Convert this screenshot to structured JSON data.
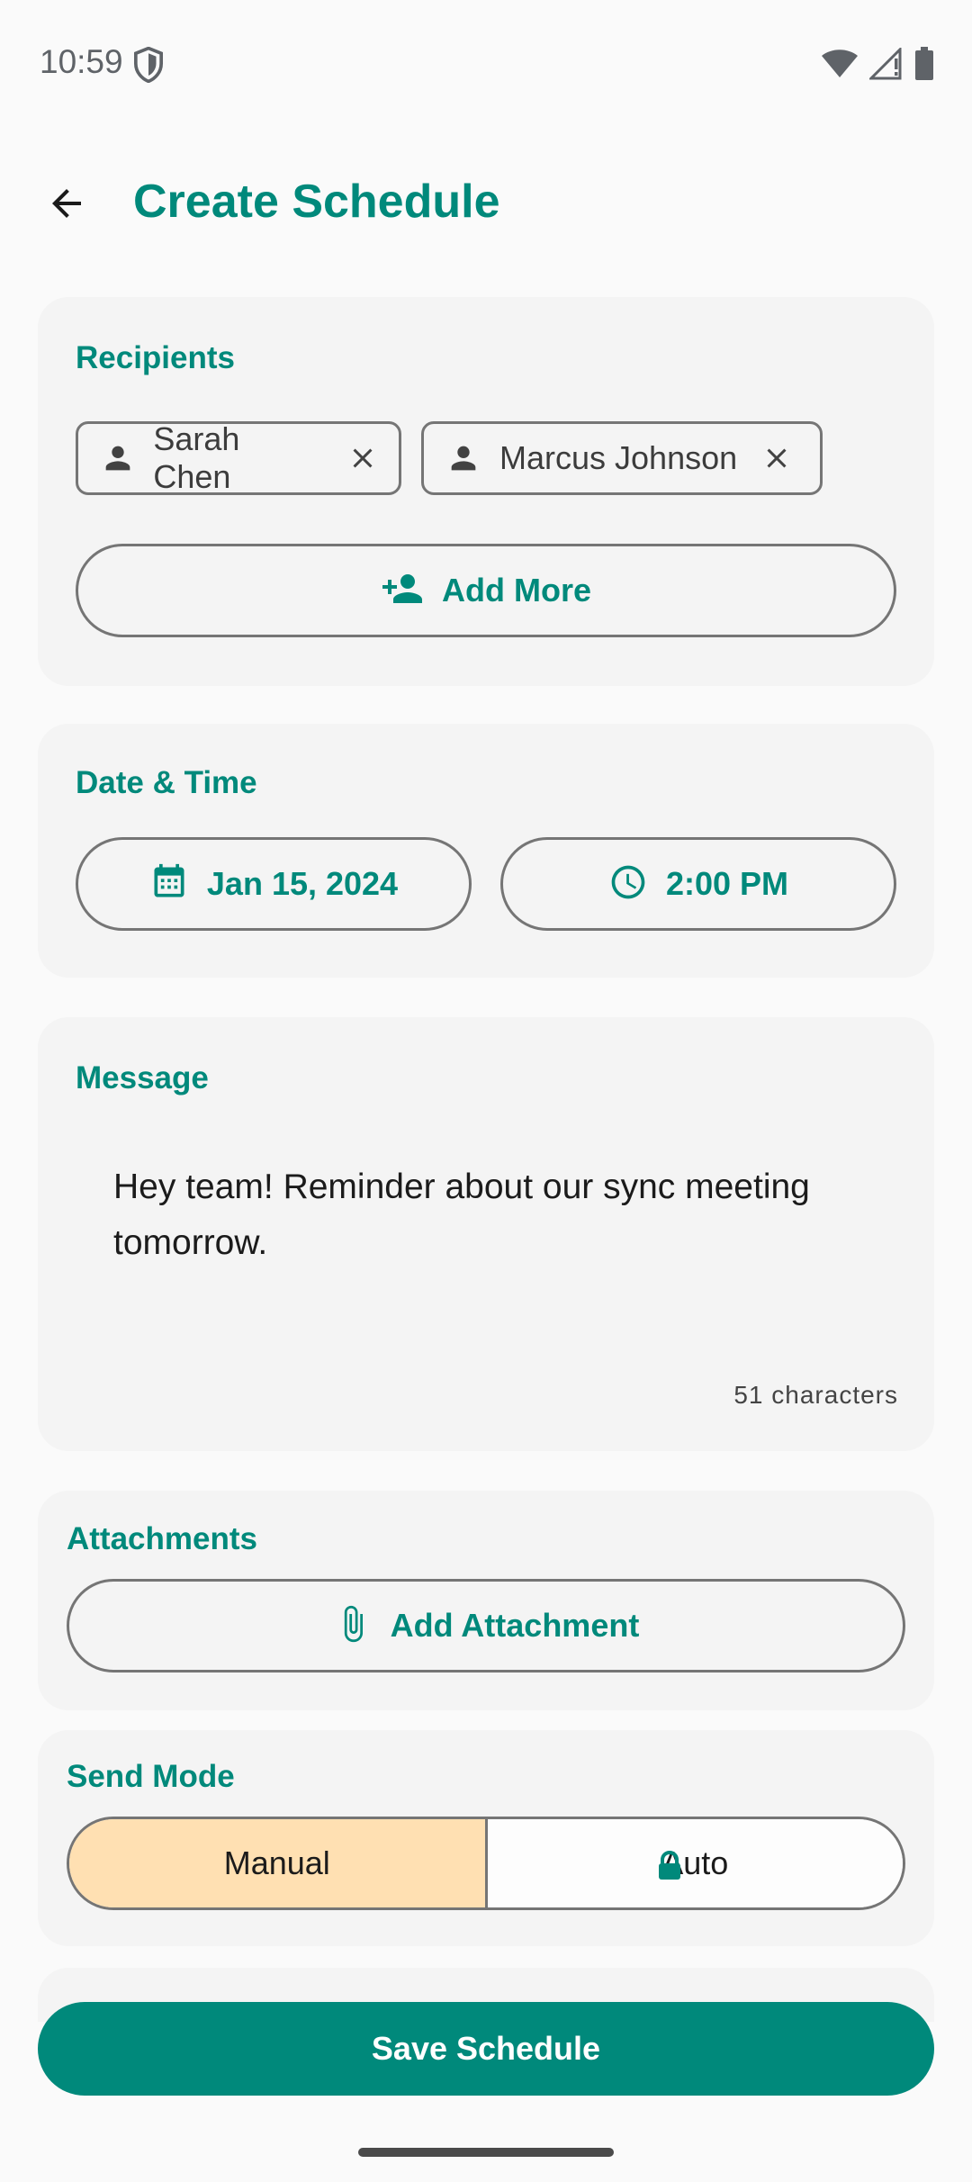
{
  "status_bar": {
    "time": "10:59",
    "icons": [
      "shield-icon",
      "wifi-icon",
      "signal-icon",
      "battery-icon"
    ]
  },
  "header": {
    "title": "Create Schedule",
    "back_icon": "arrow-back-icon"
  },
  "recipients": {
    "title": "Recipients",
    "chips": [
      {
        "label": "Sarah Chen",
        "icon": "person-icon"
      },
      {
        "label": "Marcus Johnson",
        "icon": "person-icon"
      }
    ],
    "add_label": "Add More",
    "add_icon": "person-add-icon"
  },
  "datetime": {
    "title": "Date & Time",
    "date_label": "Jan 15, 2024",
    "date_icon": "calendar-icon",
    "time_label": "2:00 PM",
    "time_icon": "clock-icon"
  },
  "message": {
    "title": "Message",
    "text_line1": "Hey team! Reminder about our sync meeting",
    "text_line2": "tomorrow.",
    "char_count": "51 characters"
  },
  "attachments": {
    "title": "Attachments",
    "add_label": "Add Attachment",
    "add_icon": "paperclip-icon"
  },
  "send_mode": {
    "title": "Send Mode",
    "options": [
      "Manual",
      "Auto"
    ],
    "selected": "Manual",
    "auto_overlay_icon": "lock-icon"
  },
  "footer": {
    "save_label": "Save Schedule"
  },
  "colors": {
    "accent": "#00897b",
    "selected_segment": "#ffe0b2",
    "card_bg": "#f4f4f4",
    "page_bg": "#fafafa"
  }
}
